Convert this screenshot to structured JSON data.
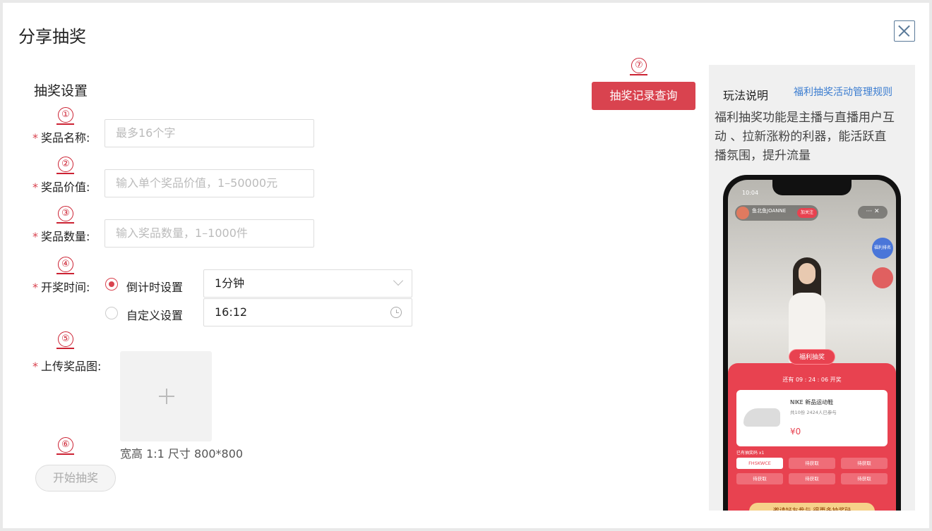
{
  "dialog": {
    "title": "分享抽奖",
    "section_title": "抽奖设置"
  },
  "markers": [
    "①",
    "②",
    "③",
    "④",
    "⑤",
    "⑥",
    "⑦"
  ],
  "form": {
    "required_mark": "*",
    "prize_name": {
      "label": "奖品名称:",
      "placeholder": "最多16个字"
    },
    "prize_value": {
      "label": "奖品价值:",
      "placeholder": "输入单个奖品价值，1–50000元"
    },
    "prize_quantity": {
      "label": "奖品数量:",
      "placeholder": "输入奖品数量，1–1000件"
    },
    "draw_time": {
      "label": "开奖时间:",
      "countdown_option": "倒计时设置",
      "countdown_value": "1分钟",
      "custom_option": "自定义设置",
      "custom_value": "16:12",
      "selected": "countdown"
    },
    "upload": {
      "label": "上传奖品图:",
      "hint": "宽高 1:1 尺寸 800*800"
    },
    "start_button": "开始抽奖"
  },
  "record_button": "抽奖记录查询",
  "guide": {
    "title": "玩法说明",
    "rules_link": "福利抽奖活动管理规则",
    "description": "福利抽奖功能是主播与直播用户互动 、拉新涨粉的利器，能活跃直播氛围，提升流量"
  },
  "phone_preview": {
    "time": "10:04",
    "host_name": "鱼北鱼JOANNE",
    "follow": "加关注",
    "menu": "··· ✕",
    "badge": "福利排名",
    "card_title": "福利抽奖",
    "countdown": "还有 09 : 24 : 06 开奖",
    "product_name": "NIKE 新品运动鞋",
    "product_sub": "共10份  2424人已参与",
    "price": "¥0",
    "codes_label": "已有抽奖码 x1",
    "codes": [
      "FHSKWCE",
      "待获取",
      "待获取",
      "待获取",
      "待获取",
      "待获取"
    ],
    "bottom_button": "邀请好友参与 得更多抽奖码"
  },
  "colors": {
    "accent": "#d9434f",
    "link": "#3a7cd0",
    "marker": "#cc2233"
  }
}
